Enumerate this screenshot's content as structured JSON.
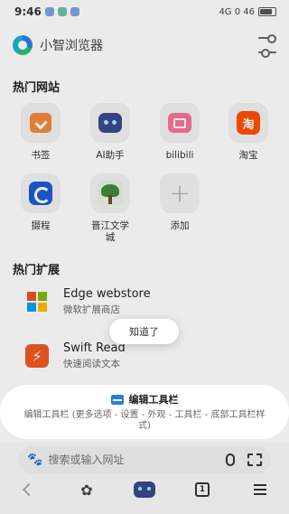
{
  "status_bar": {
    "time": "9:46",
    "right": "4G 0 46"
  },
  "header": {
    "app_title": "小智浏览器"
  },
  "hot_sites": {
    "title": "热门网站",
    "items": [
      {
        "label": "书签",
        "icon": "bookmark-icon"
      },
      {
        "label": "AI助手",
        "icon": "robot-icon"
      },
      {
        "label": "bilibili",
        "icon": "bilibili-icon"
      },
      {
        "label": "淘宝",
        "icon": "taobao-icon",
        "glyph": "淘"
      },
      {
        "label": "摄程",
        "icon": "ctrip-icon"
      },
      {
        "label": "晋江文学城",
        "icon": "jjwxc-icon"
      },
      {
        "label": "添加",
        "icon": "plus-icon",
        "glyph": "+"
      }
    ]
  },
  "hot_extensions": {
    "title": "热门扩展",
    "items": [
      {
        "name": "Edge webstore",
        "desc": "微软扩展商店",
        "icon": "microsoft-icon"
      },
      {
        "name": "Swift Read",
        "desc": "快速阅读文本",
        "icon": "swift-read-icon",
        "glyph": "⚡"
      }
    ]
  },
  "toast": {
    "label": "知道了"
  },
  "spotlight": {
    "title": "编辑工具栏",
    "desc": "编辑工具栏 (更多选项 - 设置 - 外观 - 工具栏 - 底部工具栏样式)"
  },
  "search": {
    "placeholder": "搜索或输入网址"
  },
  "bottom_nav": {
    "tab_count": "1"
  },
  "colors": {
    "ms_red": "#f25022",
    "ms_green": "#7fba00",
    "ms_blue": "#00a4ef",
    "ms_yellow": "#ffb900",
    "accent_blue": "#2d7be0"
  }
}
